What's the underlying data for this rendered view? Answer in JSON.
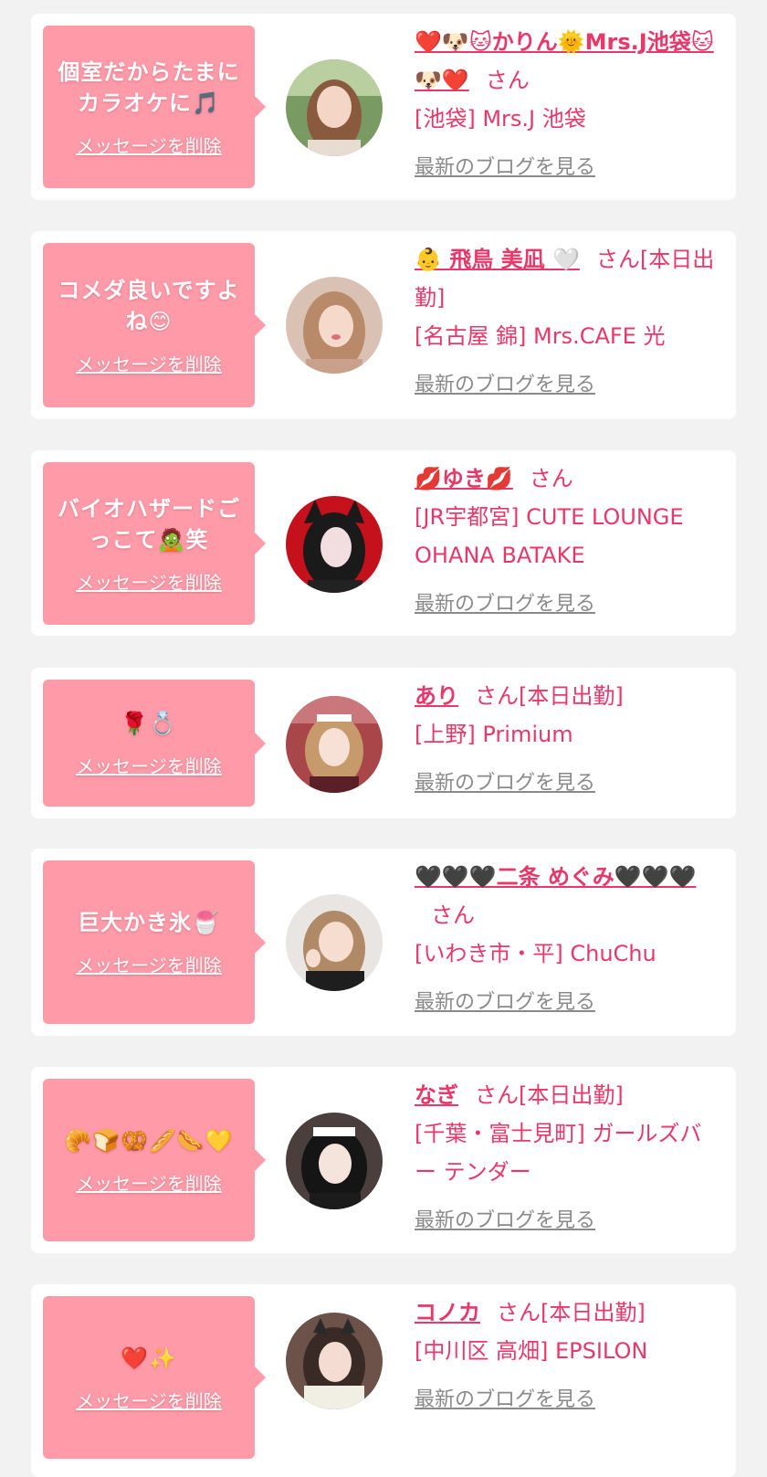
{
  "theme": {
    "page_background": "#f2f2f2",
    "card_background": "#ffffff",
    "bubble_color": "#ff9aa8",
    "accent_pink": "#e8386a",
    "link_gray": "#8a8a8a"
  },
  "messages": [
    {
      "message": "個室だからたまにカラオケに🎵",
      "delete_label": "メッセージを削除",
      "name": "❤️🐶🐱かりん🌞Mrs.J池袋🐱🐶❤️",
      "honorific": "さん",
      "status": "",
      "shop": "[池袋] Mrs.J 池袋",
      "blog_label": "最新のブログを見る",
      "avatar_icon": "avatar-photo-icon"
    },
    {
      "message": "コメダ良いですよね😊",
      "delete_label": "メッセージを削除",
      "name": "👶 飛鳥 美凪 🤍",
      "honorific": "さん",
      "status": "[本日出勤]",
      "shop": "[名古屋 錦] Mrs.CAFE 光",
      "blog_label": "最新のブログを見る",
      "avatar_icon": "avatar-photo-icon"
    },
    {
      "message": "バイオハザードごっこて🧟笑",
      "delete_label": "メッセージを削除",
      "name": "💋ゆき💋",
      "honorific": "さん",
      "status": "",
      "shop": "[JR宇都宮] CUTE LOUNGE OHANA BATAKE",
      "blog_label": "最新のブログを見る",
      "avatar_icon": "avatar-photo-icon"
    },
    {
      "message": "🌹💍",
      "delete_label": "メッセージを削除",
      "name": "あり",
      "honorific": "さん",
      "status": "[本日出勤]",
      "shop": "[上野] Primium",
      "blog_label": "最新のブログを見る",
      "avatar_icon": "avatar-photo-icon"
    },
    {
      "message": "巨大かき氷🍧",
      "delete_label": "メッセージを削除",
      "name": "🖤🖤🖤二条 めぐみ🖤🖤🖤",
      "honorific": "さん",
      "status": "",
      "shop": "[いわき市・平] ChuChu",
      "blog_label": "最新のブログを見る",
      "avatar_icon": "avatar-photo-icon"
    },
    {
      "message": "🥐🍞🥨🥖🌭💛",
      "delete_label": "メッセージを削除",
      "name": "なぎ",
      "honorific": "さん",
      "status": "[本日出勤]",
      "shop": "[千葉・富士見町] ガールズバー テンダー",
      "blog_label": "最新のブログを見る",
      "avatar_icon": "avatar-photo-icon"
    },
    {
      "message": "❤️✨",
      "delete_label": "メッセージを削除",
      "name": "コノカ",
      "honorific": "さん",
      "status": "[本日出勤]",
      "shop": "[中川区 高畑] EPSILON",
      "blog_label": "最新のブログを見る",
      "avatar_icon": "avatar-photo-icon"
    }
  ]
}
